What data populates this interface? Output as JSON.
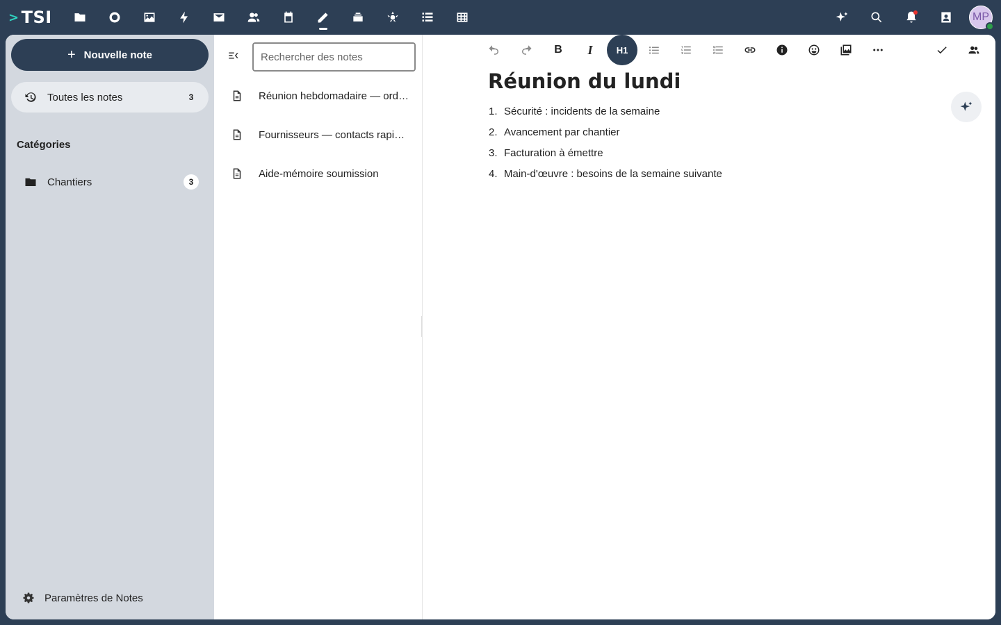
{
  "brand": {
    "logo_text": "TSI",
    "logo_chevron": ">"
  },
  "topbar": {
    "apps": [
      {
        "icon": "folder-icon"
      },
      {
        "icon": "circle-icon"
      },
      {
        "icon": "image-icon"
      },
      {
        "icon": "lightning-icon"
      },
      {
        "icon": "mail-icon"
      },
      {
        "icon": "contacts-icon"
      },
      {
        "icon": "calendar-icon"
      },
      {
        "icon": "pencil-icon",
        "active": true
      },
      {
        "icon": "stack-icon"
      },
      {
        "icon": "activity-icon"
      },
      {
        "icon": "checklist-icon"
      },
      {
        "icon": "table-icon"
      }
    ],
    "avatar_initials": "MP"
  },
  "nav": {
    "new_note_label": "Nouvelle note",
    "all_notes_label": "Toutes les notes",
    "all_notes_count": "3",
    "categories_title": "Catégories",
    "categories": [
      {
        "label": "Chantiers",
        "count": "3"
      }
    ],
    "settings_label": "Paramètres de Notes"
  },
  "list": {
    "search_placeholder": "Rechercher des notes",
    "notes": [
      {
        "title": "Réunion hebdomadaire — ordre du jour"
      },
      {
        "title": "Fournisseurs — contacts rapides"
      },
      {
        "title": "Aide-mémoire soumission"
      }
    ]
  },
  "editor": {
    "heading_button_label": "H1",
    "bold_label": "B",
    "italic_label": "I",
    "title": "Réunion du lundi",
    "items": [
      {
        "num": "1.",
        "text": "Sécurité : incidents de la semaine"
      },
      {
        "num": "2.",
        "text": "Avancement par chantier"
      },
      {
        "num": "3.",
        "text": "Facturation à émettre"
      },
      {
        "num": "4.",
        "text": "Main-d'œuvre : besoins de la semaine suivante"
      }
    ]
  },
  "colors": {
    "header_bg": "#2d3f55",
    "nav_bg": "#d3d8df",
    "accent": "#2fd3c0"
  }
}
